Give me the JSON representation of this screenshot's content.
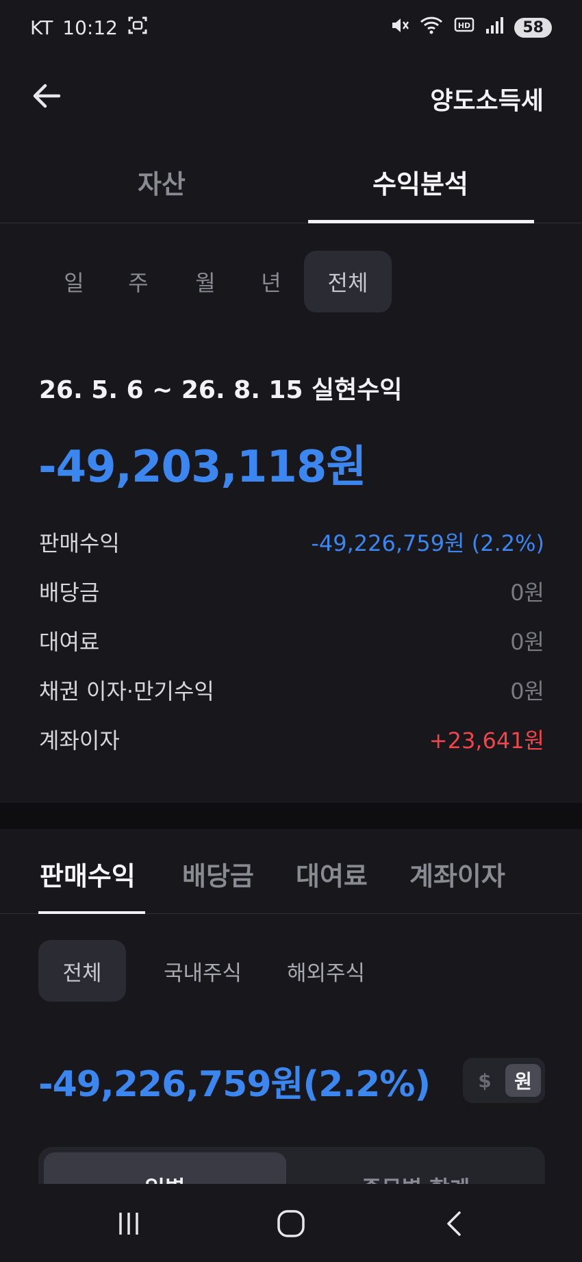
{
  "status_bar": {
    "carrier": "KT",
    "time": "10:12",
    "battery": "58"
  },
  "header": {
    "title": "양도소득세"
  },
  "main_tabs": {
    "asset": "자산",
    "profit_analysis": "수익분석"
  },
  "period_tabs": [
    "일",
    "주",
    "월",
    "년",
    "전체"
  ],
  "summary": {
    "period_label": "26. 5. 6 ~ 26. 8. 15 실현수익",
    "realized_total": "-49,203,118원",
    "rows": [
      {
        "label": "판매수익",
        "value": "-49,226,759원 (2.2%)"
      },
      {
        "label": "배당금",
        "value": "0원"
      },
      {
        "label": "대여료",
        "value": "0원"
      },
      {
        "label": "채권 이자·만기수익",
        "value": "0원"
      },
      {
        "label": "계좌이자",
        "value": "+23,641원"
      }
    ]
  },
  "sub_tabs": [
    "판매수익",
    "배당금",
    "대여료",
    "계좌이자"
  ],
  "market_filter": [
    "전체",
    "국내주식",
    "해외주식"
  ],
  "sales": {
    "total": "-49,226,759원(2.2%)",
    "currency_dollar": "$",
    "currency_won": "원"
  },
  "view_toggle": {
    "daily": "일별",
    "by_stock": "종목별 합계"
  },
  "colors": {
    "background": "#17171c",
    "loss_blue": "#3c86f0",
    "gain_red": "#f0454a"
  }
}
